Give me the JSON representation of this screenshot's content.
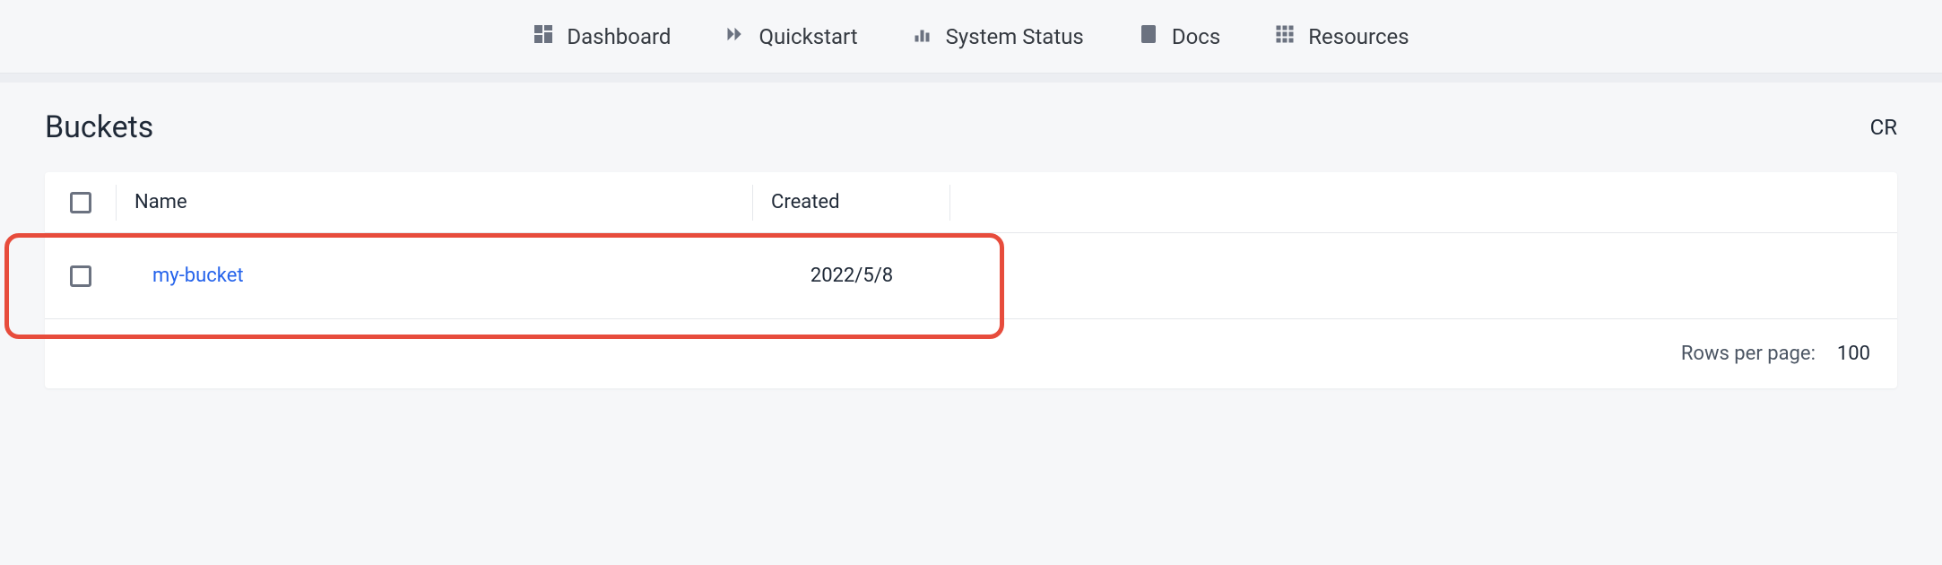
{
  "nav": {
    "dashboard": "Dashboard",
    "quickstart": "Quickstart",
    "system_status": "System Status",
    "docs": "Docs",
    "resources": "Resources"
  },
  "page": {
    "title": "Buckets",
    "create_button": "CR"
  },
  "table": {
    "headers": {
      "name": "Name",
      "created": "Created"
    },
    "rows": [
      {
        "name": "my-bucket",
        "created": "2022/5/8"
      }
    ]
  },
  "pagination": {
    "label": "Rows per page:",
    "value": "100"
  }
}
